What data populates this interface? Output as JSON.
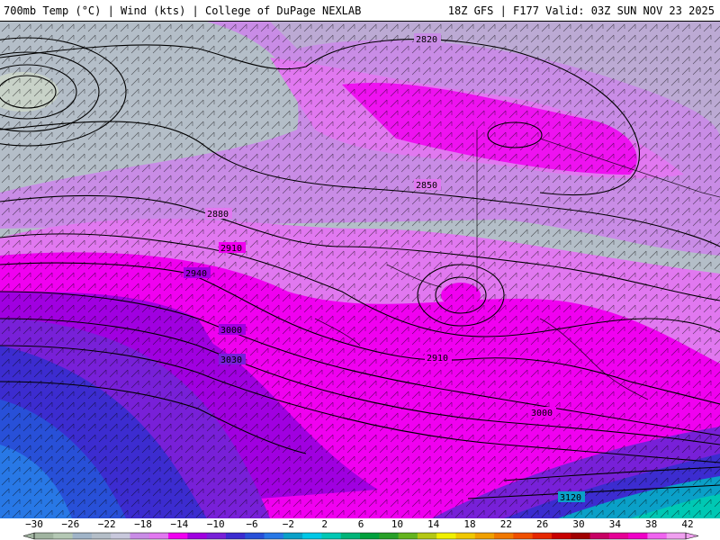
{
  "header": {
    "left": "700mb Temp (°C) | Wind (kts) | College of DuPage NEXLAB",
    "right": "18Z GFS | F177 Valid: 03Z SUN NOV 23 2025"
  },
  "colors": {
    "cold_gray": "#b4bec8",
    "lavender": "#c98ce6",
    "light_magenta": "#e178f0",
    "magenta": "#f000f0",
    "purple": "#a000e0",
    "violet": "#7820d8",
    "deep_blue": "#3c2cd0",
    "blue": "#2850d8",
    "teal": "#0aa0c8",
    "aqua": "#00c8b4"
  },
  "contour_labels": [
    "2820",
    "2850",
    "2880",
    "2910",
    "2940",
    "3000",
    "3030",
    "2910",
    "3000",
    "3120"
  ],
  "legend": {
    "tick_labels": [
      "−30",
      "−26",
      "−22",
      "−18",
      "−14",
      "−10",
      "−6",
      "−2",
      "2",
      "6",
      "10",
      "14",
      "18",
      "22",
      "26",
      "30",
      "34",
      "38",
      "42"
    ],
    "swatches": [
      "#a0b4a0",
      "#b4c8b4",
      "#a0b4c8",
      "#b4bec8",
      "#c8c8dc",
      "#c98ce6",
      "#e178f0",
      "#f000f0",
      "#a000e0",
      "#7820d8",
      "#3c2cd0",
      "#2850d8",
      "#2878e6",
      "#0aa0c8",
      "#00c8e6",
      "#00c8b4",
      "#00b478",
      "#00a03c",
      "#28a028",
      "#64b41e",
      "#b4c814",
      "#f0f000",
      "#f0c800",
      "#f0a000",
      "#f07800",
      "#f05000",
      "#e62800",
      "#c80000",
      "#a00000",
      "#c80064",
      "#e60096",
      "#f000c8",
      "#f064f0",
      "#f0a0f0"
    ]
  }
}
